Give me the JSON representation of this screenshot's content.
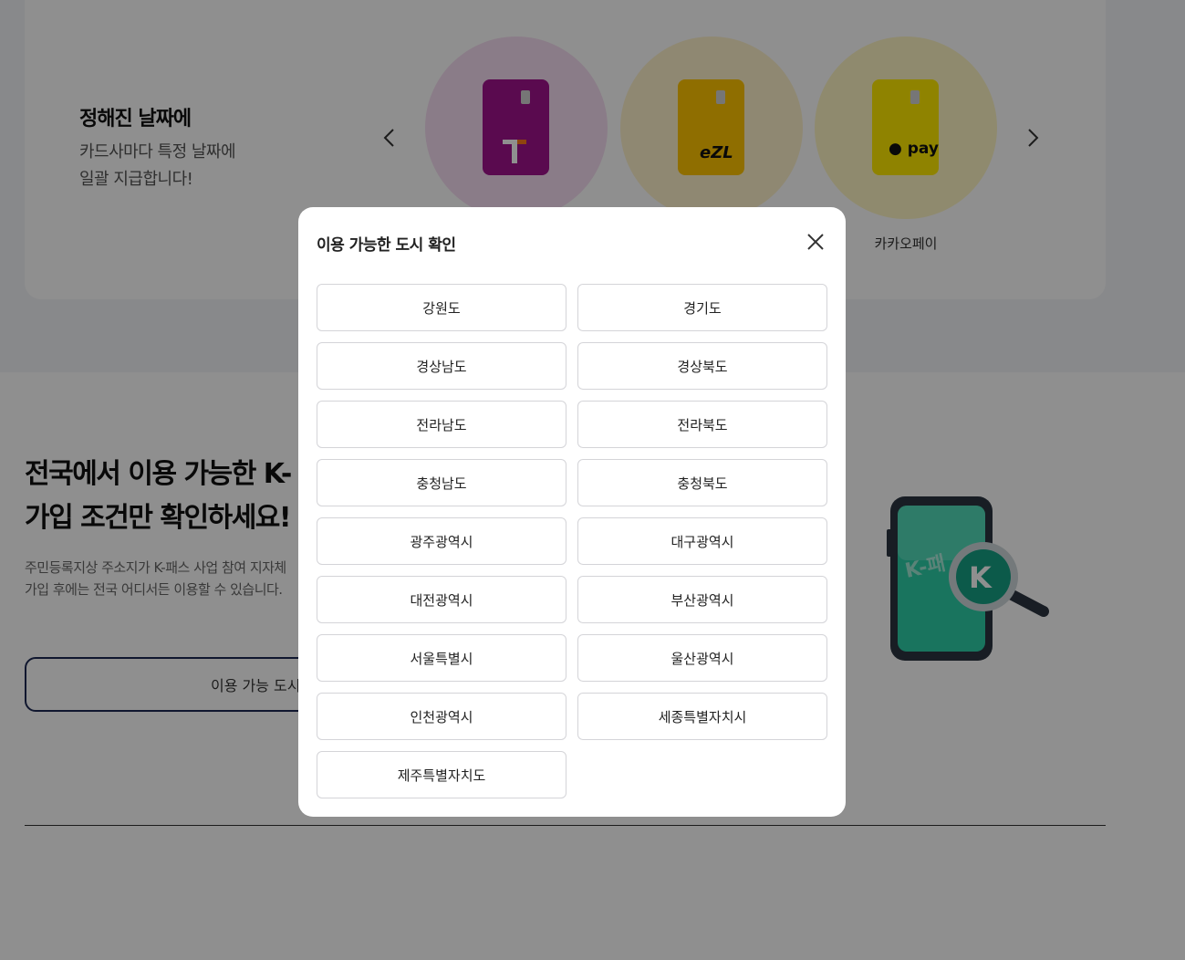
{
  "payment_section": {
    "title": "정해진 날짜에",
    "desc_line1": "카드사마다 특정 날짜에",
    "desc_line2": "일괄 지급합니다!",
    "cards": [
      {
        "name": "tmoney",
        "color": "#a0138d"
      },
      {
        "name": "ezl",
        "logo_text": "eZL",
        "color": "#ffc400"
      },
      {
        "name": "kakaopay",
        "logo_text": "pay",
        "label": "카카오페이",
        "color": "#ffea00"
      }
    ],
    "prev_icon": "chevron-left-icon",
    "next_icon": "chevron-right-icon"
  },
  "kpass_section": {
    "title_line1": "전국에서 이용 가능한 K-",
    "title_line2": "가입 조건만 확인하세요!",
    "desc_line1": "주민등록지상 주소지가 K-패스 사업 참여 지자체",
    "desc_line2": "가입 후에는 전국 어디서든 이용할 수 있습니다.",
    "button_label": "이용 가능 도시 ",
    "illustration_text": "K-패"
  },
  "modal": {
    "title": "이용 가능한 도시 확인",
    "close_icon": "close-icon",
    "cities": [
      "강원도",
      "경기도",
      "경상남도",
      "경상북도",
      "전라남도",
      "전라북도",
      "충청남도",
      "충청북도",
      "광주광역시",
      "대구광역시",
      "대전광역시",
      "부산광역시",
      "서울특별시",
      "울산광역시",
      "인천광역시",
      "세종특별자치시",
      "제주특별자치도"
    ]
  }
}
